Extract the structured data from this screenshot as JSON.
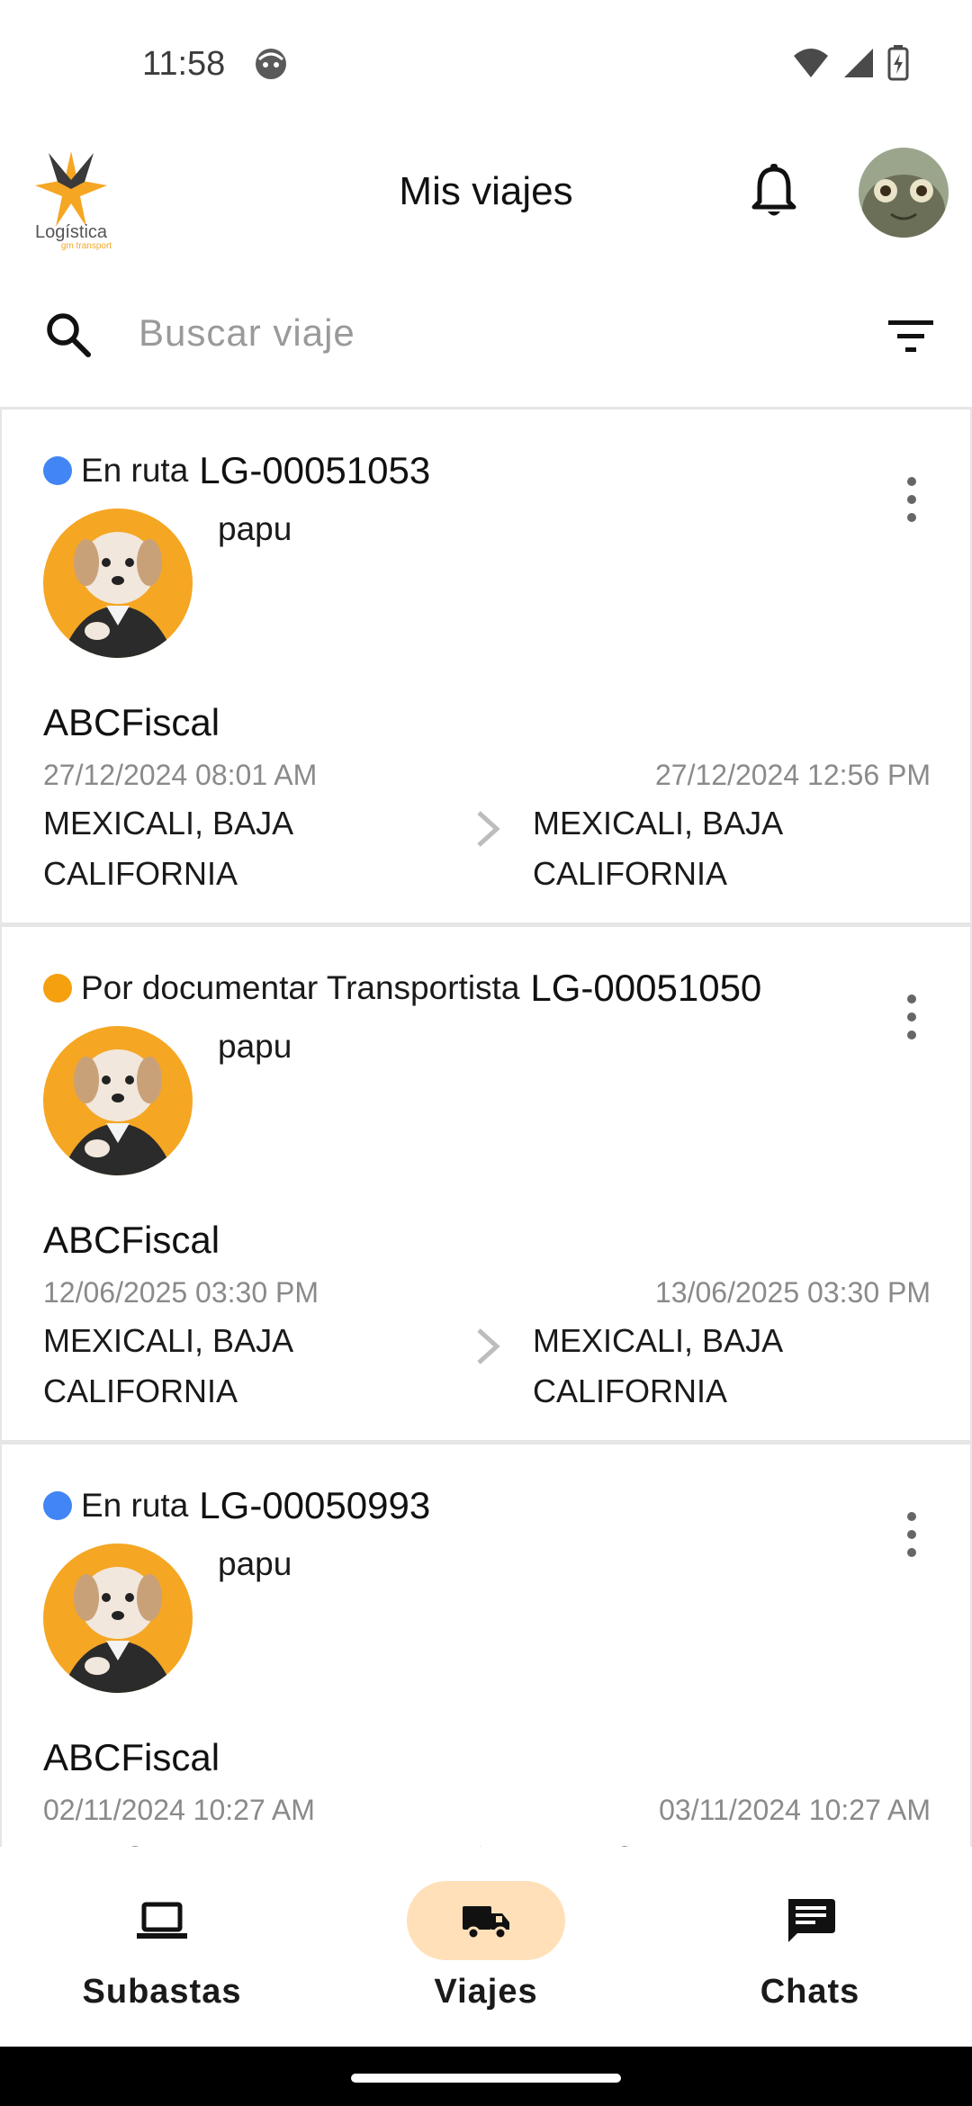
{
  "status_bar": {
    "time": "11:58"
  },
  "header": {
    "title": "Mis viajes",
    "logo_text": "Logística gm transport"
  },
  "search": {
    "placeholder": "Buscar viaje",
    "value": ""
  },
  "trips": [
    {
      "status": "En ruta",
      "status_color": "#4285F4",
      "id": "LG-00051053",
      "driver": "papu",
      "company": "ABCFiscal",
      "start_date": "27/12/2024 08:01 AM",
      "end_date": "27/12/2024 12:56 PM",
      "origin": "MEXICALI, BAJA CALIFORNIA",
      "destination": "MEXICALI, BAJA CALIFORNIA"
    },
    {
      "status": "Por documentar Transportista",
      "status_color": "#F5A00F",
      "id": "LG-00051050",
      "driver": "papu",
      "company": "ABCFiscal",
      "start_date": "12/06/2025 03:30 PM",
      "end_date": "13/06/2025 03:30 PM",
      "origin": "MEXICALI, BAJA CALIFORNIA",
      "destination": "MEXICALI, BAJA CALIFORNIA"
    },
    {
      "status": "En ruta",
      "status_color": "#4285F4",
      "id": "LG-00050993",
      "driver": "papu",
      "company": "ABCFiscal",
      "start_date": "02/11/2024 10:27 AM",
      "end_date": "03/11/2024 10:27 AM",
      "origin": "MEXICALI, BAJA CALIFORNIA",
      "destination": "MEXICALI, BAJA CALIFORNIA"
    }
  ],
  "nav": {
    "items": [
      {
        "label": "Subastas",
        "icon": "laptop-icon",
        "active": false
      },
      {
        "label": "Viajes",
        "icon": "truck-icon",
        "active": true
      },
      {
        "label": "Chats",
        "icon": "chat-icon",
        "active": false
      }
    ],
    "active_pill_color": "#FFE0B8"
  }
}
